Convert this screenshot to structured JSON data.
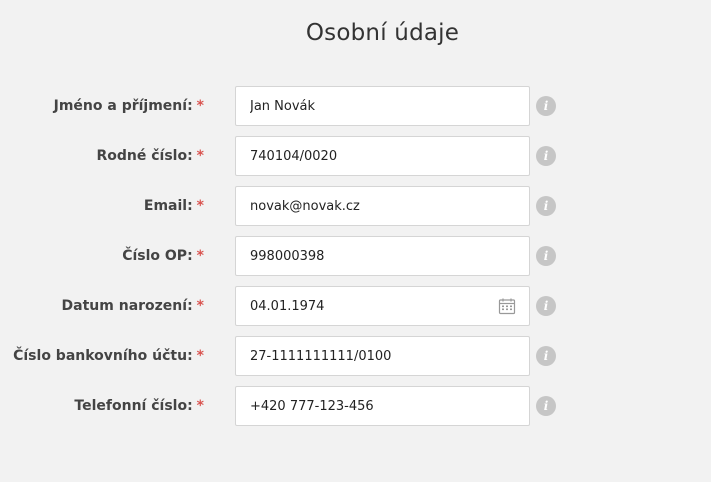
{
  "page": {
    "title": "Osobní údaje"
  },
  "form": {
    "required_marker": "*",
    "info_glyph": "i",
    "fields": [
      {
        "label": "Jméno a příjmení:",
        "value": "Jan Novák"
      },
      {
        "label": "Rodné číslo:",
        "value": "740104/0020"
      },
      {
        "label": "Email:",
        "value": "novak@novak.cz"
      },
      {
        "label": "Číslo OP:",
        "value": "998000398"
      },
      {
        "label": "Datum narození:",
        "value": "04.01.1974",
        "icon": "calendar-icon"
      },
      {
        "label": "Číslo bankovního účtu:",
        "value": "27-1111111111/0100"
      },
      {
        "label": "Telefonní číslo:",
        "value": "+420 777-123-456"
      }
    ]
  },
  "colors": {
    "background": "#f2f2f2",
    "required": "#d9534f",
    "info_icon": "#c6c6c6",
    "input_border": "#d5d5d5"
  }
}
